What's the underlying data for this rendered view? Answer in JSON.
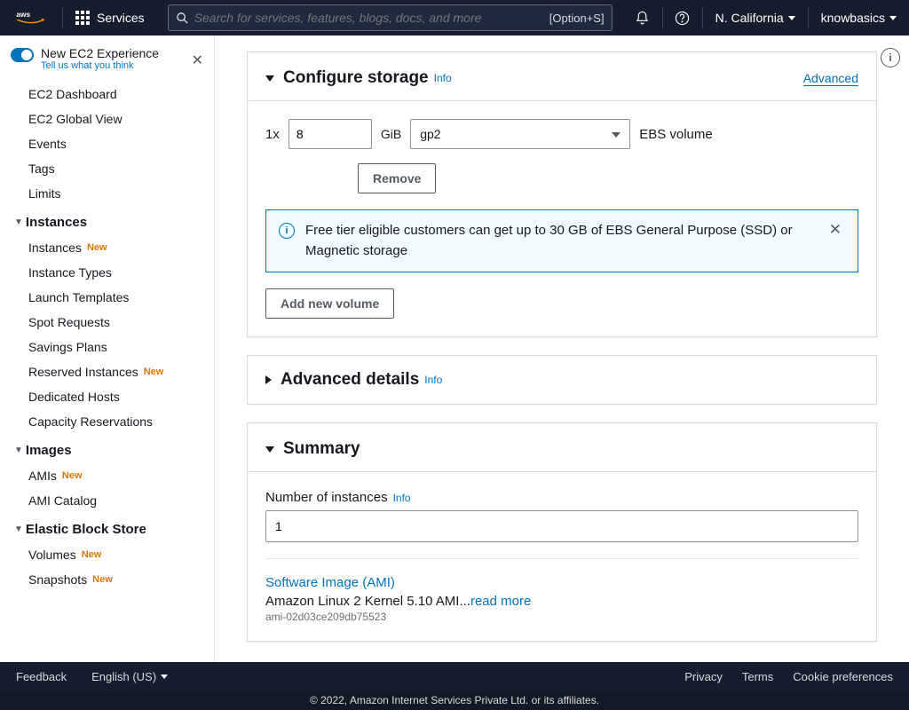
{
  "header": {
    "services_label": "Services",
    "search_placeholder": "Search for services, features, blogs, docs, and more",
    "search_shortcut": "[Option+S]",
    "region": "N. California",
    "username": "knowbasics"
  },
  "new_experience": {
    "title": "New EC2 Experience",
    "subtitle": "Tell us what you think"
  },
  "nav": {
    "top": [
      "EC2 Dashboard",
      "EC2 Global View",
      "Events",
      "Tags",
      "Limits"
    ],
    "instances_heading": "Instances",
    "instances_items": [
      {
        "label": "Instances",
        "badge": "New"
      },
      {
        "label": "Instance Types"
      },
      {
        "label": "Launch Templates"
      },
      {
        "label": "Spot Requests"
      },
      {
        "label": "Savings Plans"
      },
      {
        "label": "Reserved Instances",
        "badge": "New"
      },
      {
        "label": "Dedicated Hosts"
      },
      {
        "label": "Capacity Reservations"
      }
    ],
    "images_heading": "Images",
    "images_items": [
      {
        "label": "AMIs",
        "badge": "New"
      },
      {
        "label": "AMI Catalog"
      }
    ],
    "ebs_heading": "Elastic Block Store",
    "ebs_items": [
      {
        "label": "Volumes",
        "badge": "New"
      },
      {
        "label": "Snapshots",
        "badge": "New"
      }
    ]
  },
  "storage_panel": {
    "title": "Configure storage",
    "info_label": "Info",
    "advanced_link": "Advanced",
    "qty_prefix": "1x",
    "size_value": "8",
    "size_unit": "GiB",
    "type_value": "gp2",
    "suffix": "EBS volume",
    "remove_btn": "Remove",
    "alert": "Free tier eligible customers can get up to 30 GB of EBS General Purpose (SSD) or Magnetic storage",
    "add_btn": "Add new volume"
  },
  "advanced_panel": {
    "title": "Advanced details",
    "info_label": "Info"
  },
  "summary_panel": {
    "title": "Summary",
    "instances_label": "Number of instances",
    "instances_info": "Info",
    "instances_value": "1",
    "ami_heading": "Software Image (AMI)",
    "ami_desc": "Amazon Linux 2 Kernel 5.10 AMI...",
    "ami_readmore": "read more",
    "ami_id": "ami-02d03ce209db75523"
  },
  "footer": {
    "feedback": "Feedback",
    "language": "English (US)",
    "privacy": "Privacy",
    "terms": "Terms",
    "cookies": "Cookie preferences",
    "copyright": "© 2022, Amazon Internet Services Private Ltd. or its affiliates."
  }
}
